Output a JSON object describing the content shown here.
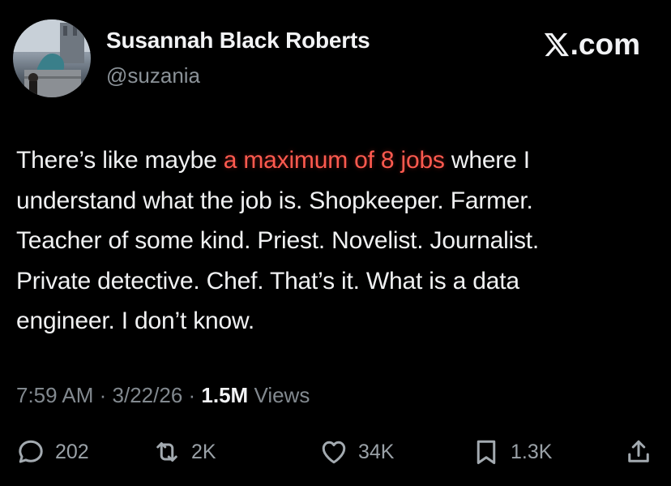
{
  "author": {
    "name": "Susannah Black Roberts",
    "handle": "@suzania"
  },
  "brand": {
    "label": ".com",
    "logo_icon": "x-logo-icon"
  },
  "tweet": {
    "lines": [
      {
        "before": "There’s like maybe ",
        "highlight": "a maximum of 8 jobs",
        "after": " where I"
      },
      {
        "text": "understand what the job is. Shopkeeper. Farmer."
      },
      {
        "text": "Teacher of some kind. Priest. Novelist. Journalist."
      },
      {
        "text": "Private detective. Chef. That’s it. What is a data"
      },
      {
        "text": "engineer. I don’t know."
      }
    ],
    "highlight_color": "#ff5a4f"
  },
  "meta": {
    "time": "7:59 AM",
    "date": "3/22/26",
    "views_count": "1.5M",
    "views_label": "Views"
  },
  "actions": {
    "reply": {
      "icon": "reply-icon",
      "count": "202"
    },
    "repost": {
      "icon": "repost-icon",
      "count": "2K"
    },
    "like": {
      "icon": "heart-icon",
      "count": "34K"
    },
    "bookmark": {
      "icon": "bookmark-icon",
      "count": "1.3K"
    },
    "share": {
      "icon": "share-icon"
    }
  }
}
